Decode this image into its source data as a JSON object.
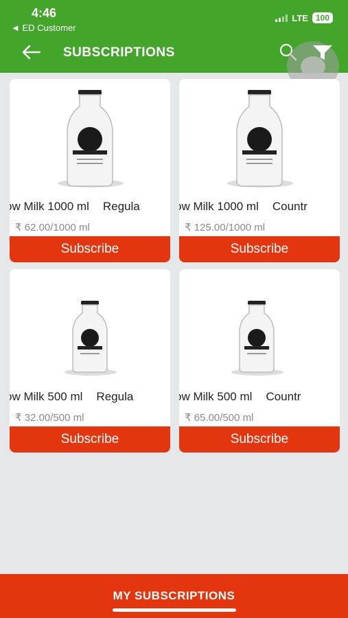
{
  "status_bar": {
    "time": "4:46",
    "back_app": "◄ ED Customer",
    "network": "LTE",
    "battery": "100"
  },
  "nav": {
    "title": "SUBSCRIPTIONS",
    "back_icon": "back-arrow-icon",
    "search_icon": "search-icon",
    "filter_icon": "filter-icon"
  },
  "products": [
    {
      "name": "ow Milk 1000 ml",
      "variety": "Regula",
      "price": "₹ 62.00/1000 ml",
      "button": "Subscribe"
    },
    {
      "name": "ow Milk 1000 ml",
      "variety": "Countr",
      "price": "₹ 125.00/1000 ml",
      "button": "Subscribe"
    },
    {
      "name": "ow Milk 500 ml",
      "variety": "Regula",
      "price": "₹ 32.00/500 ml",
      "button": "Subscribe"
    },
    {
      "name": "ow Milk 500 ml",
      "variety": "Countr",
      "price": "₹ 65.00/500 ml",
      "button": "Subscribe"
    }
  ],
  "bottom": {
    "label": "MY SUBSCRIPTIONS"
  },
  "colors": {
    "header": "#43a62a",
    "accent": "#e3360f",
    "background": "#e6e7e9"
  }
}
